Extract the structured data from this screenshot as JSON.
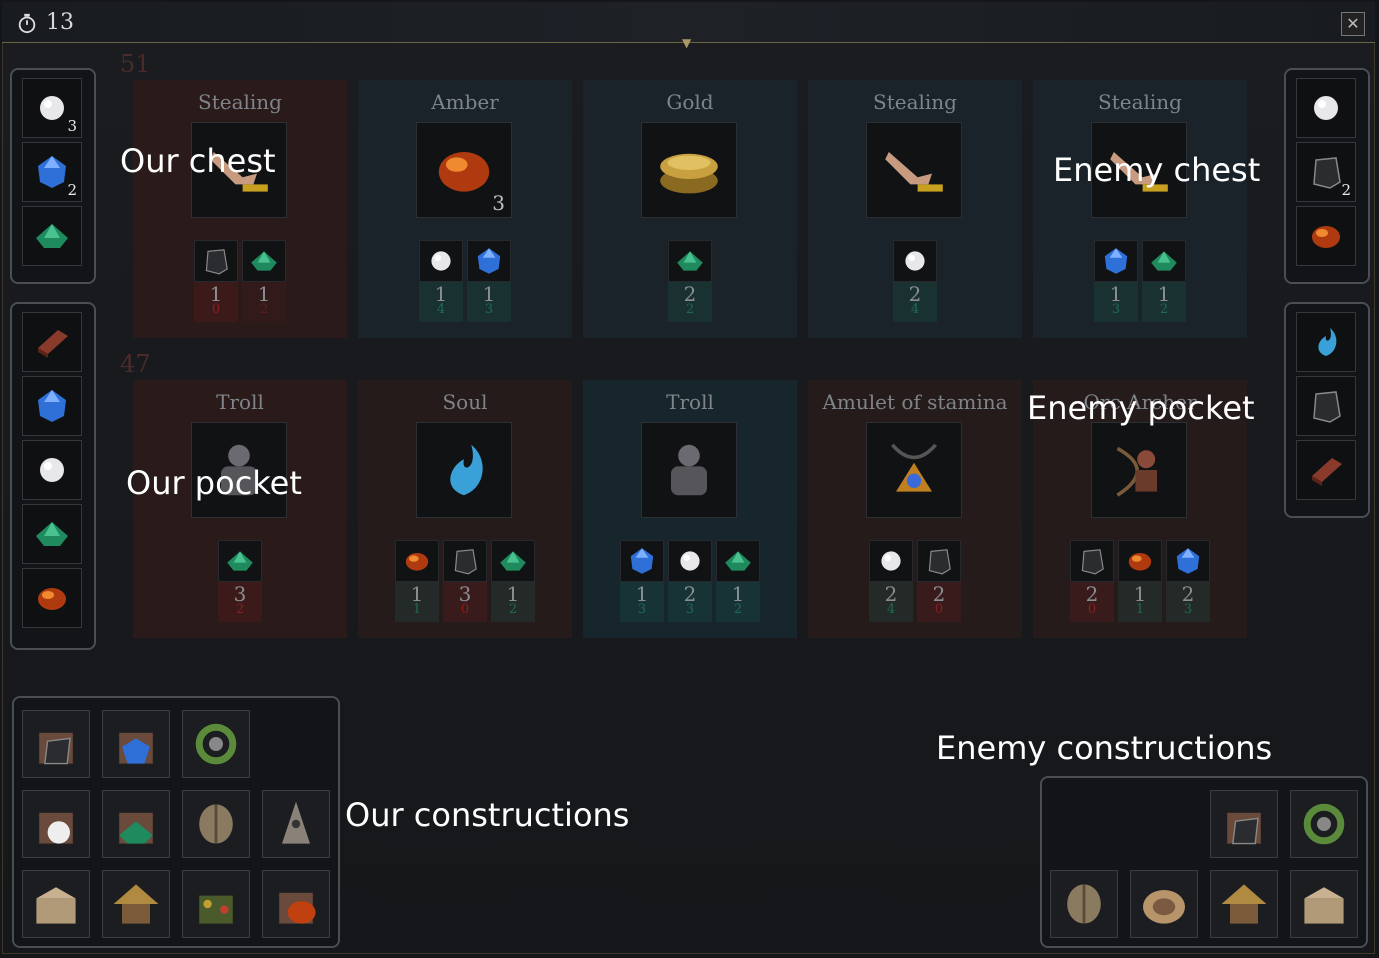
{
  "timer": "13",
  "close_glyph": "✕",
  "labels": {
    "our_chest": "Our chest",
    "enemy_chest": "Enemy chest",
    "our_pocket": "Our pocket",
    "enemy_pocket": "Enemy pocket",
    "our_constructions": "Our constructions",
    "enemy_constructions": "Enemy constructions"
  },
  "rows": [
    {
      "number": "51",
      "cards": [
        {
          "title": "Stealing",
          "icon": "stealing-hand-icon",
          "count": "",
          "reqs": [
            {
              "icon": "coal-icon",
              "a": "1",
              "b": "0",
              "bcolor": "#8a1e1e"
            },
            {
              "icon": "emerald-icon",
              "a": "1",
              "b": "2",
              "bcolor": "#5a1e1e"
            }
          ]
        },
        {
          "title": "Amber",
          "icon": "amber-icon",
          "count": "3",
          "reqs": [
            {
              "icon": "pearl-icon",
              "a": "1",
              "b": "4",
              "bcolor": "#1e6a5a"
            },
            {
              "icon": "sapphire-icon",
              "a": "1",
              "b": "3",
              "bcolor": "#1e6a5a"
            }
          ]
        },
        {
          "title": "Gold",
          "icon": "gold-coins-icon",
          "count": "",
          "reqs": [
            {
              "icon": "emerald-icon",
              "a": "2",
              "b": "2",
              "bcolor": "#1e6a5a"
            }
          ]
        },
        {
          "title": "Stealing",
          "icon": "stealing-hand-icon",
          "count": "",
          "reqs": [
            {
              "icon": "pearl-icon",
              "a": "2",
              "b": "4",
              "bcolor": "#1e6a5a"
            }
          ]
        },
        {
          "title": "Stealing",
          "icon": "stealing-hand-icon",
          "count": "",
          "reqs": [
            {
              "icon": "sapphire-icon",
              "a": "1",
              "b": "3",
              "bcolor": "#1e6a5a"
            },
            {
              "icon": "emerald-icon",
              "a": "1",
              "b": "2",
              "bcolor": "#1e6a5a"
            }
          ]
        }
      ]
    },
    {
      "number": "47",
      "cards": [
        {
          "title": "Troll",
          "icon": "troll-icon",
          "count": "",
          "reqs": [
            {
              "icon": "emerald-icon",
              "a": "3",
              "b": "2",
              "bcolor": "#8a1e1e"
            }
          ]
        },
        {
          "title": "Soul",
          "icon": "soul-icon",
          "count": "",
          "reqs": [
            {
              "icon": "amber-icon",
              "a": "1",
              "b": "1",
              "bcolor": "#1e6a5a"
            },
            {
              "icon": "coal-icon",
              "a": "3",
              "b": "0",
              "bcolor": "#8a1e1e"
            },
            {
              "icon": "emerald-icon",
              "a": "1",
              "b": "2",
              "bcolor": "#1e6a5a"
            }
          ]
        },
        {
          "title": "Troll",
          "icon": "troll-icon",
          "count": "",
          "reqs": [
            {
              "icon": "sapphire-icon",
              "a": "1",
              "b": "3",
              "bcolor": "#1e6a5a"
            },
            {
              "icon": "pearl-icon",
              "a": "2",
              "b": "3",
              "bcolor": "#1e6a5a"
            },
            {
              "icon": "emerald-icon",
              "a": "1",
              "b": "2",
              "bcolor": "#1e6a5a"
            }
          ]
        },
        {
          "title": "Amulet of stamina",
          "icon": "amulet-icon",
          "count": "",
          "reqs": [
            {
              "icon": "pearl-icon",
              "a": "2",
              "b": "4",
              "bcolor": "#1e6a5a"
            },
            {
              "icon": "coal-icon",
              "a": "2",
              "b": "0",
              "bcolor": "#8a1e1e"
            }
          ]
        },
        {
          "title": "Orc Archer",
          "icon": "orc-archer-icon",
          "count": "",
          "reqs": [
            {
              "icon": "coal-icon",
              "a": "2",
              "b": "0",
              "bcolor": "#8a1e1e"
            },
            {
              "icon": "amber-icon",
              "a": "1",
              "b": "1",
              "bcolor": "#1e6a5a"
            },
            {
              "icon": "sapphire-icon",
              "a": "2",
              "b": "3",
              "bcolor": "#1e6a5a"
            }
          ]
        }
      ]
    }
  ],
  "our_chest": [
    {
      "icon": "pearl-icon",
      "count": "3"
    },
    {
      "icon": "sapphire-icon",
      "count": "2"
    },
    {
      "icon": "emerald-icon",
      "count": ""
    }
  ],
  "our_pocket": [
    {
      "icon": "brick-icon",
      "count": ""
    },
    {
      "icon": "sapphire-icon",
      "count": ""
    },
    {
      "icon": "pearl-icon",
      "count": ""
    },
    {
      "icon": "emerald-icon",
      "count": ""
    },
    {
      "icon": "amber-icon",
      "count": ""
    }
  ],
  "enemy_chest": [
    {
      "icon": "pearl-icon",
      "count": ""
    },
    {
      "icon": "coal-icon",
      "count": "2"
    },
    {
      "icon": "amber-icon",
      "count": ""
    }
  ],
  "enemy_pocket": [
    {
      "icon": "soul-icon",
      "count": ""
    },
    {
      "icon": "coal-icon",
      "count": ""
    },
    {
      "icon": "brick-icon",
      "count": ""
    }
  ],
  "our_constructions": [
    [
      "coal-mine-icon",
      "sapphire-mine-icon",
      "wreath-icon"
    ],
    [
      "pearl-mine-icon",
      "emerald-mine-icon",
      "shield-stand-icon",
      "tower-icon"
    ],
    [
      "chest-building-icon",
      "hut-icon",
      "garden-icon",
      "amber-mine-icon"
    ]
  ],
  "enemy_constructions": [
    [
      "coal-mine-icon",
      "wreath-icon"
    ],
    [
      "shield-stand-icon",
      "arena-icon",
      "hut-icon",
      "chest-building-icon"
    ]
  ]
}
